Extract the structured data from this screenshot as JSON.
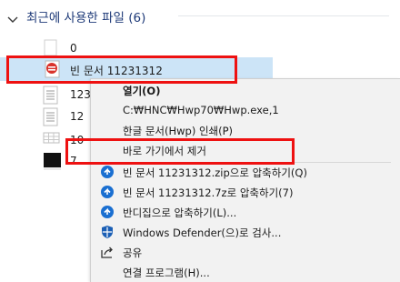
{
  "section": {
    "title": "최근에 사용한 파일 (6)",
    "icon": "chevron-down-icon"
  },
  "files": [
    {
      "name": "0",
      "icon": "document-icon"
    },
    {
      "name": "빈 문서 11231312",
      "icon": "hwp-document-icon",
      "selected": true
    },
    {
      "name": "123",
      "icon": "text-document-icon"
    },
    {
      "name": "12",
      "icon": "text-document-icon"
    },
    {
      "name": "10",
      "icon": "spreadsheet-icon"
    },
    {
      "name": "7",
      "icon": "terminal-document-icon"
    }
  ],
  "context_menu": {
    "items": [
      {
        "label": "열기(O)",
        "icon": "",
        "bold": true
      },
      {
        "label": "C:₩HNC₩Hwp70₩Hwp.exe,1",
        "icon": ""
      },
      {
        "label": "한글 문서(Hwp) 인쇄(P)",
        "icon": ""
      },
      {
        "label": "바로 가기에서 제거",
        "icon": ""
      },
      {
        "label": "빈 문서 11231312.zip으로 압축하기(Q)",
        "icon": "bandizip-icon"
      },
      {
        "label": "빈 문서 11231312.7z로 압축하기(7)",
        "icon": "bandizip-icon"
      },
      {
        "label": "반디집으로 압축하기(L)...",
        "icon": "bandizip-icon"
      },
      {
        "label": "Windows Defender(으)로 검사...",
        "icon": "windows-defender-icon"
      },
      {
        "label": "공유",
        "icon": "share-icon"
      },
      {
        "label": "연결 프로그램(H)...",
        "icon": ""
      }
    ]
  },
  "colors": {
    "header_text": "#1e3a78",
    "selection": "#cce4f7",
    "menu_bg": "#f2f2f2",
    "highlight_box": "#ee1111",
    "bandizip_blue": "#1a6fd1"
  }
}
